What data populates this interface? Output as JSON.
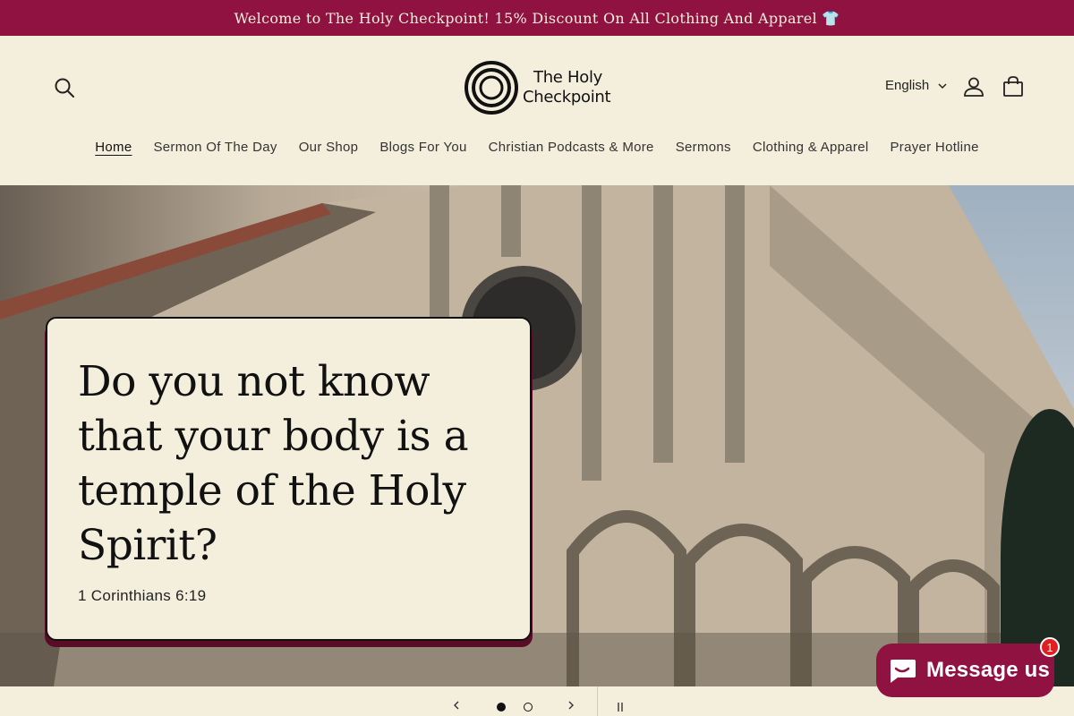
{
  "announcement": "Welcome to The Holy Checkpoint! 15% Discount On All Clothing And Apparel 👕",
  "header": {
    "logo": {
      "line1": "The Holy",
      "line2": "Checkpoint"
    },
    "language": "English",
    "icons": [
      "search-icon",
      "account-icon",
      "cart-icon",
      "chevron-down-icon"
    ]
  },
  "nav": {
    "items": [
      {
        "label": "Home",
        "active": true
      },
      {
        "label": "Sermon Of The Day"
      },
      {
        "label": "Our Shop"
      },
      {
        "label": "Blogs For You"
      },
      {
        "label": "Christian Podcasts & More"
      },
      {
        "label": "Sermons"
      },
      {
        "label": "Clothing & Apparel"
      },
      {
        "label": "Prayer Hotline"
      }
    ]
  },
  "hero": {
    "quote": "Do you not know that your body is a temple of the Holy Spirit?",
    "reference": "1 Corinthians 6:19"
  },
  "slider": {
    "current": 1,
    "total": 2
  },
  "chat": {
    "label": "Message us",
    "badge": "1"
  },
  "colors": {
    "brand": "#8f1240",
    "background": "#f3efdc"
  }
}
